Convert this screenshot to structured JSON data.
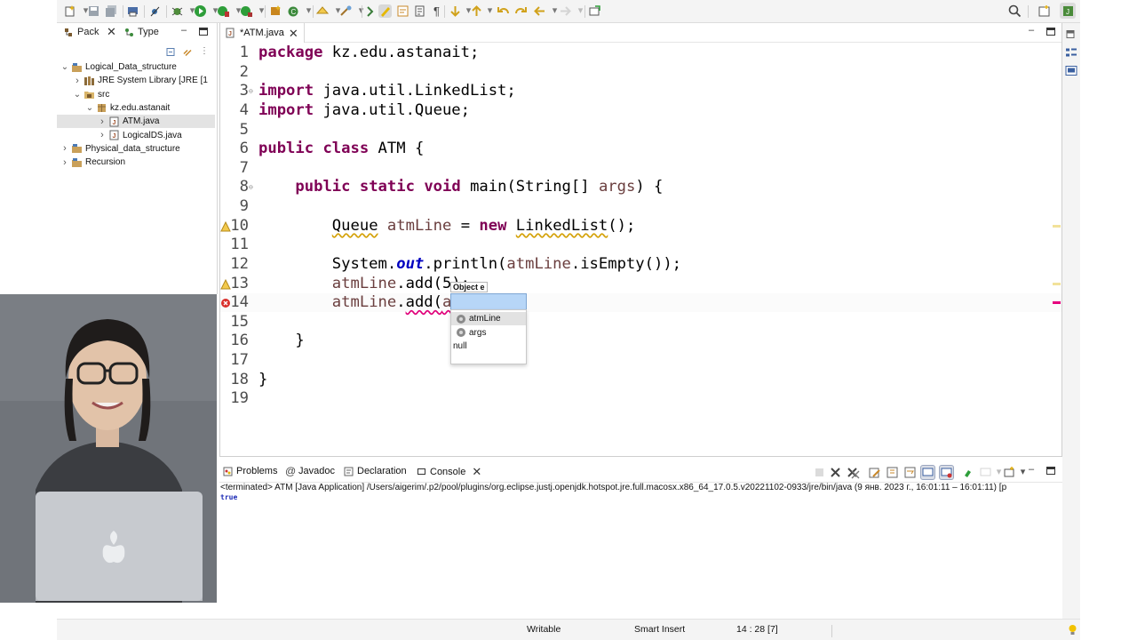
{
  "toolbar": {
    "icons": [
      "new-icon",
      "save-icon",
      "save-all-icon",
      "print-icon",
      "skip-breakpoints-icon",
      "debug-icon",
      "run-icon",
      "coverage-icon",
      "external-tools-icon",
      "new-java-package-icon",
      "new-java-class-icon",
      "open-type-icon",
      "search-icon",
      "next-annotation-icon",
      "highlight-icon",
      "toggle-mark-occurrences-icon",
      "word-wrap-icon",
      "show-whitespace-icon",
      "next-edit-icon",
      "previous-edit-icon",
      "back-icon",
      "forward-icon",
      "pin-editor-icon",
      "quick-access-search-icon",
      "open-perspective-icon",
      "java-perspective-icon"
    ]
  },
  "package_explorer": {
    "tabs": [
      {
        "label": "Pack",
        "icon": "package-explorer-icon"
      },
      {
        "label": "Type",
        "icon": "type-hierarchy-icon"
      }
    ],
    "tree": [
      {
        "label": "Logical_Data_structure",
        "level": 0,
        "expanded": true,
        "icon": "project-icon"
      },
      {
        "label": "JRE System Library [JRE [1",
        "level": 1,
        "expanded": false,
        "icon": "library-icon"
      },
      {
        "label": "src",
        "level": 1,
        "expanded": true,
        "icon": "source-folder-icon"
      },
      {
        "label": "kz.edu.astanait",
        "level": 2,
        "expanded": true,
        "icon": "package-icon"
      },
      {
        "label": "ATM.java",
        "level": 3,
        "expanded": false,
        "icon": "java-file-icon",
        "selected": true
      },
      {
        "label": "LogicalDS.java",
        "level": 3,
        "expanded": false,
        "icon": "java-file-icon"
      },
      {
        "label": "Physical_data_structure",
        "level": 0,
        "expanded": false,
        "icon": "project-icon"
      },
      {
        "label": "Recursion",
        "level": 0,
        "expanded": false,
        "icon": "project-icon"
      }
    ]
  },
  "editor": {
    "tab_label": "*ATM.java",
    "lines": [
      {
        "n": "1",
        "tokens": [
          {
            "t": "package",
            "c": "kw"
          },
          {
            "t": " kz.edu.astanait;"
          }
        ]
      },
      {
        "n": "2",
        "tokens": []
      },
      {
        "n": "3",
        "fold": true,
        "tokens": [
          {
            "t": "import",
            "c": "kw"
          },
          {
            "t": " java.util.LinkedList;"
          }
        ]
      },
      {
        "n": "4",
        "tokens": [
          {
            "t": "import",
            "c": "kw"
          },
          {
            "t": " java.util.Queue;"
          }
        ]
      },
      {
        "n": "5",
        "tokens": []
      },
      {
        "n": "6",
        "tokens": [
          {
            "t": "public",
            "c": "kw"
          },
          {
            "t": " "
          },
          {
            "t": "class",
            "c": "kw"
          },
          {
            "t": " ATM {"
          }
        ]
      },
      {
        "n": "7",
        "tokens": []
      },
      {
        "n": "8",
        "fold": true,
        "tokens": [
          {
            "t": "    "
          },
          {
            "t": "public",
            "c": "kw"
          },
          {
            "t": " "
          },
          {
            "t": "static",
            "c": "kw"
          },
          {
            "t": " "
          },
          {
            "t": "void",
            "c": "kw"
          },
          {
            "t": " main(String[] "
          },
          {
            "t": "args",
            "c": "var"
          },
          {
            "t": ") {"
          }
        ]
      },
      {
        "n": "9",
        "tokens": []
      },
      {
        "n": "10",
        "marker": "warning",
        "tokens": [
          {
            "t": "        "
          },
          {
            "t": "Queue",
            "c": "warn-ul"
          },
          {
            "t": " "
          },
          {
            "t": "atmLine",
            "c": "var"
          },
          {
            "t": " = "
          },
          {
            "t": "new",
            "c": "kw"
          },
          {
            "t": " "
          },
          {
            "t": "LinkedList",
            "c": "warn-ul"
          },
          {
            "t": "();"
          }
        ]
      },
      {
        "n": "11",
        "tokens": []
      },
      {
        "n": "12",
        "tokens": [
          {
            "t": "        System."
          },
          {
            "t": "out",
            "c": "field"
          },
          {
            "t": ".println("
          },
          {
            "t": "atmLine",
            "c": "var"
          },
          {
            "t": ".isEmpty());"
          }
        ]
      },
      {
        "n": "13",
        "marker": "warning",
        "tokens": [
          {
            "t": "        "
          },
          {
            "t": "atmLine",
            "c": "var"
          },
          {
            "t": ".add(5);"
          }
        ]
      },
      {
        "n": "14",
        "marker": "error",
        "current": true,
        "tokens": [
          {
            "t": "        "
          },
          {
            "t": "atmLine",
            "c": "var"
          },
          {
            "t": "."
          },
          {
            "t": "add(",
            "c": "err-ul"
          },
          {
            "t": "atmLine",
            "c": "var err-ul"
          },
          {
            "t": ")",
            "c": "err-ul"
          }
        ]
      },
      {
        "n": "15",
        "tokens": []
      },
      {
        "n": "16",
        "tokens": [
          {
            "t": "    }"
          }
        ]
      },
      {
        "n": "17",
        "tokens": []
      },
      {
        "n": "18",
        "tokens": [
          {
            "t": "}"
          }
        ]
      },
      {
        "n": "19",
        "tokens": []
      }
    ],
    "parameter_hint": "Object e",
    "autocomplete": [
      {
        "label": "atmLine",
        "icon": "local-variable-icon",
        "selected": true
      },
      {
        "label": "args",
        "icon": "local-variable-icon"
      },
      {
        "label": "null"
      }
    ]
  },
  "console": {
    "tabs": [
      {
        "label": "Problems",
        "icon": "problems-icon"
      },
      {
        "label": "Javadoc",
        "icon": "javadoc-icon"
      },
      {
        "label": "Declaration",
        "icon": "declaration-icon"
      },
      {
        "label": "Console",
        "icon": "console-icon",
        "active": true
      }
    ],
    "terminated_line": "<terminated> ATM [Java Application] /Users/aigerim/.p2/pool/plugins/org.eclipse.justj.openjdk.hotspot.jre.full.macosx.x86_64_17.0.5.v20221102-0933/jre/bin/java  (9 янв. 2023 г., 16:01:11 – 16:01:11) [p",
    "output": "true"
  },
  "status_bar": {
    "writable": "Writable",
    "insert_mode": "Smart Insert",
    "position": "14 : 28 [7]"
  },
  "colors": {
    "keyword": "#7f0055",
    "static_field": "#0000c0",
    "local_var": "#6a3e3e",
    "console_output": "#1b2ab5",
    "selection": "#b7d6f7",
    "error": "#e0007a",
    "warning": "#d4a20a"
  }
}
